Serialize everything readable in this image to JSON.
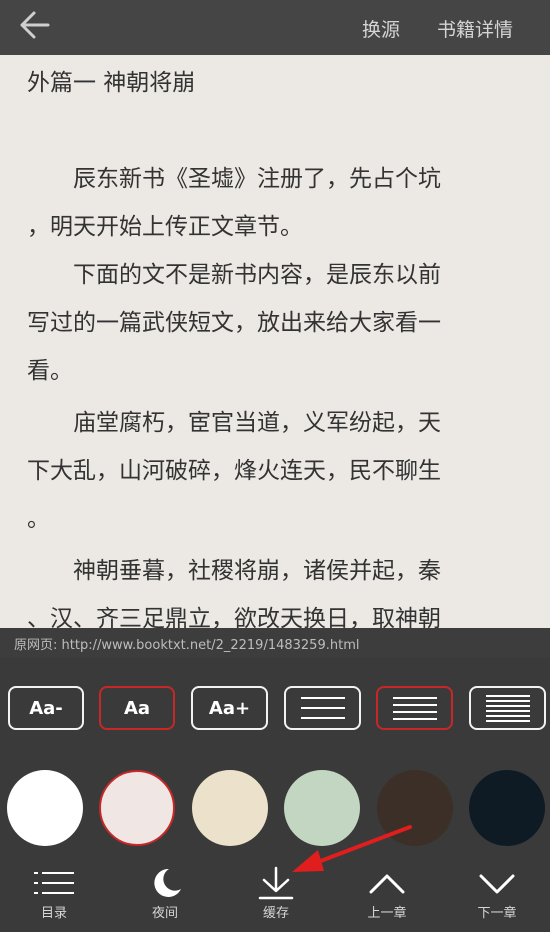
{
  "topbar": {
    "change_source": "换源",
    "book_details": "书籍详情"
  },
  "reader": {
    "chapter_title": "外篇一 神朝将崩",
    "paragraphs": [
      [
        "　　辰东新书《圣墟》注册了，先占个坑",
        "，明天开始上传正文章节。"
      ],
      [
        "　　下面的文不是新书内容，是辰东以前",
        "写过的一篇武侠短文，放出来给大家看一",
        "看。"
      ],
      [
        "　　庙堂腐朽，宦官当道，义军纷起，天",
        "下大乱，山河破碎，烽火连天，民不聊生",
        "。"
      ],
      [
        "　　神朝垂暮，社稷将崩，诸侯并起，秦",
        "、汉、齐三足鼎立，欲改天换日，取神朝"
      ]
    ]
  },
  "source_url": "原网页: http://www.booktxt.net/2_2219/1483259.html",
  "font_controls": {
    "decrease": "Aa-",
    "default": "Aa",
    "increase": "Aa+"
  },
  "themes": {
    "colors": [
      "#ffffff",
      "#f0e6e4",
      "#ece2cb",
      "#c3d6c1",
      "#3b2f27",
      "#0f1b24"
    ],
    "selected_index": 1
  },
  "bottom_nav": {
    "toc": "目录",
    "night": "夜间",
    "cache": "缓存",
    "prev": "上一章",
    "next": "下一章"
  },
  "annotation": {
    "color": "#e01e1e"
  }
}
